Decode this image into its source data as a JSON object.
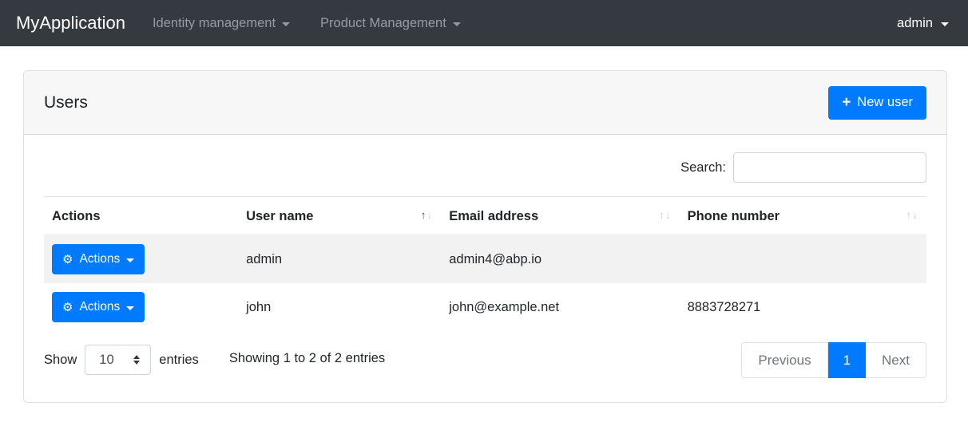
{
  "icons": {
    "plus": "+",
    "gear": "⚙",
    "sort_asc": "↑",
    "sort_desc": "↓"
  },
  "colors": {
    "primary": "#007bff",
    "navbar_bg": "#343a40",
    "stripe_row_bg": "#f2f2f2",
    "card_header_bg": "#f7f7f8",
    "muted_text": "#6c757d"
  },
  "navbar": {
    "brand": "MyApplication",
    "menus": [
      {
        "label": "Identity management"
      },
      {
        "label": "Product Management"
      }
    ],
    "user": "admin"
  },
  "card": {
    "title": "Users",
    "new_user_label": "New user"
  },
  "search": {
    "label": "Search:",
    "value": "",
    "placeholder": ""
  },
  "table": {
    "columns": [
      {
        "label": "Actions",
        "sortable": false,
        "sort": "none"
      },
      {
        "label": "User name",
        "sortable": true,
        "sort": "asc"
      },
      {
        "label": "Email address",
        "sortable": true,
        "sort": "none"
      },
      {
        "label": "Phone number",
        "sortable": true,
        "sort": "none"
      }
    ],
    "rows": [
      {
        "actions_label": "Actions",
        "user_name": "admin",
        "email": "admin4@abp.io",
        "phone": ""
      },
      {
        "actions_label": "Actions",
        "user_name": "john",
        "email": "john@example.net",
        "phone": "8883728271"
      }
    ]
  },
  "footer": {
    "show_label": "Show",
    "page_size": "10",
    "entries_label": "entries",
    "info": "Showing 1 to 2 of 2 entries",
    "pagination": {
      "previous": "Previous",
      "current_page": "1",
      "next": "Next"
    }
  }
}
